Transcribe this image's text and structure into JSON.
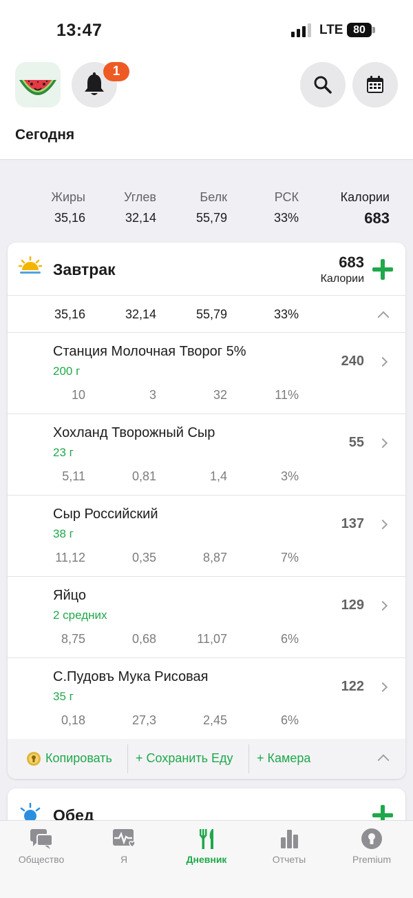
{
  "status": {
    "time": "13:47",
    "network": "LTE",
    "battery": "80"
  },
  "header": {
    "notification_count": "1",
    "title": "Сегодня",
    "icons": [
      "watermelon-logo",
      "bell-icon",
      "search-icon",
      "calendar-icon"
    ]
  },
  "summary": {
    "labels": {
      "fat": "Жиры",
      "carbs": "Углев",
      "protein": "Белк",
      "rsk": "РСК",
      "calories": "Калории"
    },
    "values": {
      "fat": "35,16",
      "carbs": "32,14",
      "protein": "55,79",
      "rsk": "33%",
      "calories": "683"
    }
  },
  "breakfast": {
    "title": "Завтрак",
    "calories": "683",
    "calories_label": "Калории",
    "totals": {
      "fat": "35,16",
      "carbs": "32,14",
      "protein": "55,79",
      "rsk": "33%"
    },
    "items": [
      {
        "name": "Станция Молочная Творог 5%",
        "qty": "200 г",
        "calories": "240",
        "fat": "10",
        "carbs": "3",
        "protein": "32",
        "rsk": "11%"
      },
      {
        "name": "Хохланд Творожный Сыр",
        "qty": "23 г",
        "calories": "55",
        "fat": "5,11",
        "carbs": "0,81",
        "protein": "1,4",
        "rsk": "3%"
      },
      {
        "name": "Сыр Российский",
        "qty": "38 г",
        "calories": "137",
        "fat": "11,12",
        "carbs": "0,35",
        "protein": "8,87",
        "rsk": "7%"
      },
      {
        "name": "Яйцо",
        "qty": "2 средних",
        "calories": "129",
        "fat": "8,75",
        "carbs": "0,68",
        "protein": "11,07",
        "rsk": "6%"
      },
      {
        "name": "С.Пудовъ Мука Рисовая",
        "qty": "35 г",
        "calories": "122",
        "fat": "0,18",
        "carbs": "27,3",
        "protein": "2,45",
        "rsk": "6%"
      }
    ],
    "actions": {
      "copy": "Копировать",
      "save": "+ Сохранить Еду",
      "camera": "+ Камера"
    }
  },
  "lunch": {
    "title": "Обед"
  },
  "tabs": [
    {
      "label": "Общество",
      "icon": "chat-icon"
    },
    {
      "label": "Я",
      "icon": "heart-pulse-icon"
    },
    {
      "label": "Дневник",
      "icon": "fork-knife-icon",
      "active": true
    },
    {
      "label": "Отчеты",
      "icon": "bar-chart-icon"
    },
    {
      "label": "Premium",
      "icon": "premium-icon"
    }
  ],
  "colors": {
    "accent": "#1fa84a",
    "badge": "#ee5a24",
    "background": "#efeff4"
  }
}
